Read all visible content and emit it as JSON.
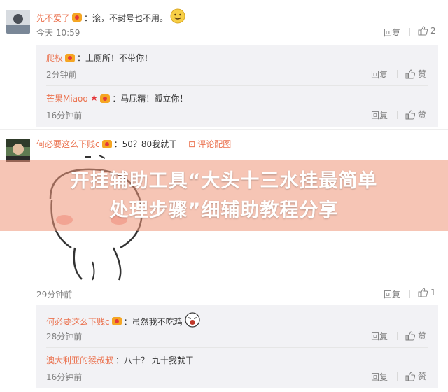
{
  "comment1": {
    "user": "先不爱了",
    "text": "：滚，不封号也不用。",
    "time": "今天 10:59",
    "reply": "回复",
    "like_count": "2"
  },
  "replies1": [
    {
      "user": "爬权",
      "text": "：上厕所！不带你！",
      "time": "2分钟前",
      "reply": "回复",
      "like": "赞"
    },
    {
      "user": "芒果Miaoo",
      "text": "：马屁精！孤立你！",
      "time": "16分钟前",
      "reply": "回复",
      "like": "赞"
    }
  ],
  "comment2": {
    "user": "何必要这么下贱c",
    "text": "：50？80我就干",
    "pic_link": "评论配图",
    "time": "29分钟前",
    "reply": "回复",
    "like_count": "1"
  },
  "replies2": [
    {
      "user": "何必要这么下贱c",
      "text": "：虽然我不吃鸡",
      "time": "28分钟前",
      "reply": "回复",
      "like": "赞"
    },
    {
      "user": "澳大利亚的猴叔叔",
      "text": "：八十？ 九十我就干",
      "time": "16分钟前",
      "reply": "回复",
      "like": "赞"
    }
  ],
  "banner": {
    "line1": "开挂辅助工具“大头十三水挂最简单",
    "line2": "处理步骤”细辅助教程分享"
  },
  "colors": {
    "name": "#eb7350",
    "meta": "#808080",
    "reply_bg": "#f2f2f5",
    "banner": "#ef9678"
  }
}
